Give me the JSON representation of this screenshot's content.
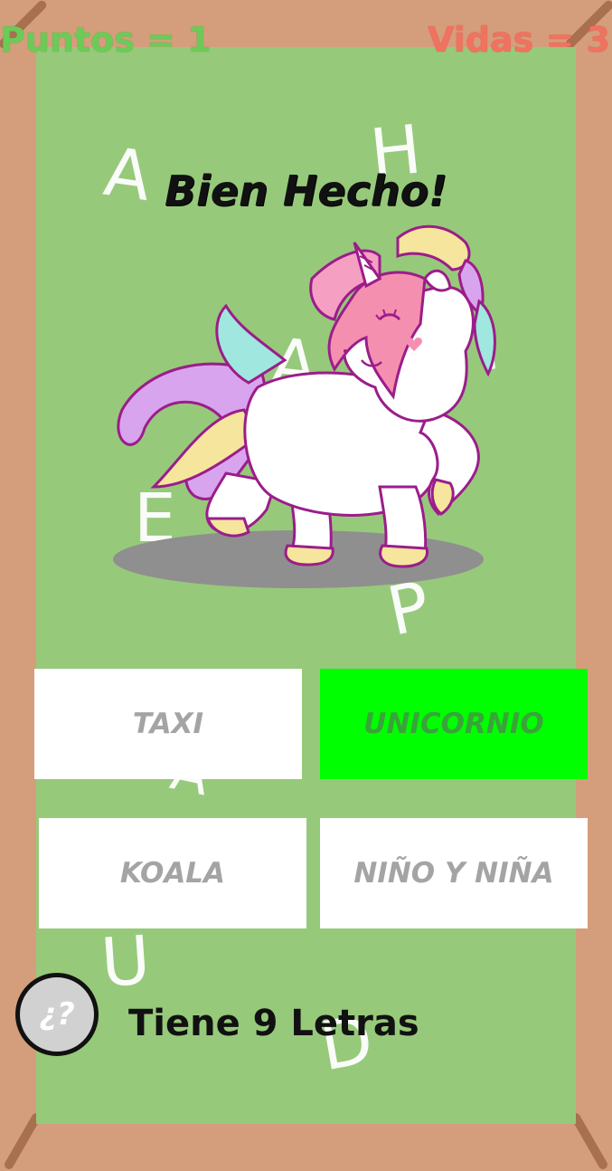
{
  "hud": {
    "points_label": "Puntos = 1",
    "lives_label": "Vidas = 3"
  },
  "feedback": {
    "title": "Bien Hecho!"
  },
  "background_letters": [
    "A",
    "H",
    "A",
    "I",
    "E",
    "P",
    "A",
    "U",
    "D"
  ],
  "picture": {
    "icon": "unicorn-icon"
  },
  "options": [
    {
      "label": "TAXI",
      "state": "default"
    },
    {
      "label": "UNICORNIO",
      "state": "correct"
    },
    {
      "label": "KOALA",
      "state": "default"
    },
    {
      "label": "NIÑO Y NIÑA",
      "state": "default"
    }
  ],
  "hint": {
    "button_label": "¿?",
    "text": "Tiene 9 Letras"
  },
  "colors": {
    "board": "#97c97b",
    "frame": "#d49e7c",
    "correct": "#00ff00",
    "points": "#6ccb57",
    "lives": "#f0725f"
  }
}
